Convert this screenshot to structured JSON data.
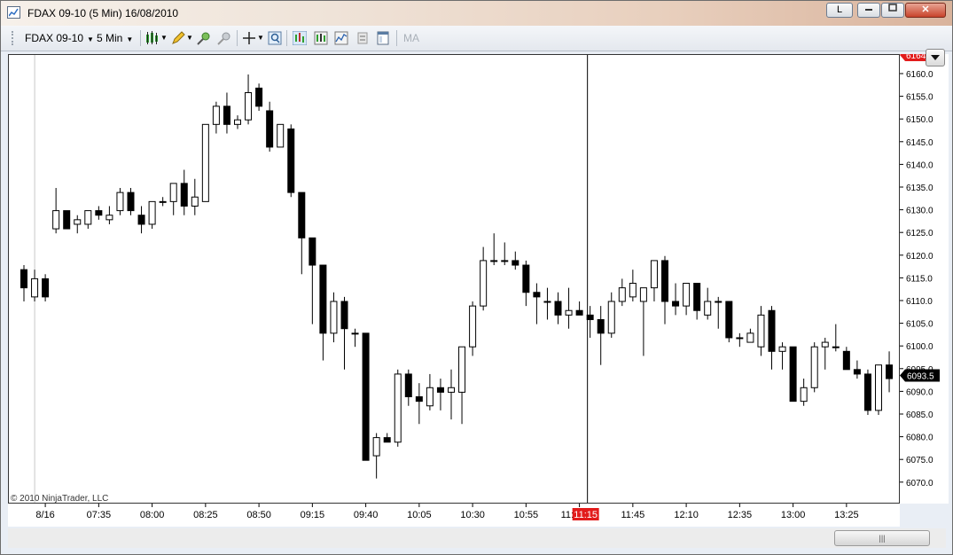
{
  "window": {
    "title": "FDAX 09-10 (5 Min)  16/08/2010",
    "buttons": {
      "link": "L",
      "minimize": "",
      "maximize": "",
      "close": "✕"
    }
  },
  "toolbar": {
    "instrument": "FDAX 09-10",
    "interval": "5 Min",
    "indicator_label": "MA"
  },
  "copyright": "© 2010 NinjaTrader, LLC",
  "crosshair_time_label": "11:15",
  "colors": {
    "up": "#ffffff",
    "down": "#000000",
    "wick": "#000000",
    "badge_red": "#e21b1b",
    "last_price_badge": "#000000"
  },
  "chart_data": {
    "type": "candlestick",
    "title": "",
    "xlabel": "",
    "ylabel": "",
    "ylim": [
      6067,
      6165
    ],
    "grid": false,
    "y_ticks": [
      "6160.0",
      "6155.0",
      "6150.0",
      "6145.0",
      "6140.0",
      "6135.0",
      "6130.0",
      "6125.0",
      "6120.0",
      "6115.0",
      "6110.0",
      "6105.0",
      "6100.0",
      "6095.0",
      "6090.0",
      "6085.0",
      "6080.0",
      "6075.0",
      "6070.0"
    ],
    "x_tick_labels": [
      "8/16",
      "07:35",
      "08:00",
      "08:25",
      "08:50",
      "09:15",
      "09:40",
      "10:05",
      "10:30",
      "10:55",
      "11:15:20",
      "11:45",
      "12:10",
      "12:35",
      "13:00",
      "13:25"
    ],
    "x_tick_bar_index": [
      2,
      7,
      12,
      17,
      22,
      27,
      32,
      37,
      42,
      47,
      52,
      57,
      62,
      67,
      72,
      77
    ],
    "last_price": "6093.5",
    "top_badge": "6164",
    "crosshair_bar_index": 53,
    "session_break_bar_index": 2,
    "candles": [
      {
        "o": 6117,
        "h": 6118,
        "l": 6110,
        "c": 6113
      },
      {
        "o": 6111,
        "h": 6117,
        "l": 6110,
        "c": 6115
      },
      {
        "o": 6115,
        "h": 6116,
        "l": 6110,
        "c": 6111
      },
      {
        "o": 6126,
        "h": 6135,
        "l": 6125,
        "c": 6130
      },
      {
        "o": 6130,
        "h": 6130,
        "l": 6126,
        "c": 6126
      },
      {
        "o": 6127,
        "h": 6129,
        "l": 6125,
        "c": 6128
      },
      {
        "o": 6127,
        "h": 6130,
        "l": 6126,
        "c": 6130
      },
      {
        "o": 6130,
        "h": 6131,
        "l": 6128,
        "c": 6129
      },
      {
        "o": 6128,
        "h": 6131,
        "l": 6127,
        "c": 6129
      },
      {
        "o": 6130,
        "h": 6135,
        "l": 6129,
        "c": 6134
      },
      {
        "o": 6134,
        "h": 6135,
        "l": 6129,
        "c": 6130
      },
      {
        "o": 6129,
        "h": 6131,
        "l": 6125,
        "c": 6127
      },
      {
        "o": 6127,
        "h": 6132,
        "l": 6126,
        "c": 6132
      },
      {
        "o": 6132,
        "h": 6133,
        "l": 6131,
        "c": 6132
      },
      {
        "o": 6132,
        "h": 6136,
        "l": 6129,
        "c": 6136
      },
      {
        "o": 6136,
        "h": 6139,
        "l": 6129,
        "c": 6131
      },
      {
        "o": 6131,
        "h": 6137,
        "l": 6129,
        "c": 6133
      },
      {
        "o": 6132,
        "h": 6149,
        "l": 6132,
        "c": 6149
      },
      {
        "o": 6149,
        "h": 6154,
        "l": 6147,
        "c": 6153
      },
      {
        "o": 6153,
        "h": 6156,
        "l": 6147,
        "c": 6149
      },
      {
        "o": 6149,
        "h": 6151,
        "l": 6148,
        "c": 6150
      },
      {
        "o": 6150,
        "h": 6160,
        "l": 6149,
        "c": 6156
      },
      {
        "o": 6157,
        "h": 6158,
        "l": 6152,
        "c": 6153
      },
      {
        "o": 6152,
        "h": 6154,
        "l": 6143,
        "c": 6144
      },
      {
        "o": 6144,
        "h": 6149,
        "l": 6144,
        "c": 6149
      },
      {
        "o": 6148,
        "h": 6149,
        "l": 6133,
        "c": 6134
      },
      {
        "o": 6134,
        "h": 6134,
        "l": 6116,
        "c": 6124
      },
      {
        "o": 6124,
        "h": 6124,
        "l": 6105,
        "c": 6118
      },
      {
        "o": 6118,
        "h": 6118,
        "l": 6097,
        "c": 6103
      },
      {
        "o": 6103,
        "h": 6112,
        "l": 6101,
        "c": 6110
      },
      {
        "o": 6110,
        "h": 6111,
        "l": 6095,
        "c": 6104
      },
      {
        "o": 6103,
        "h": 6104,
        "l": 6100,
        "c": 6103
      },
      {
        "o": 6103,
        "h": 6103,
        "l": 6075,
        "c": 6075
      },
      {
        "o": 6076,
        "h": 6081,
        "l": 6071,
        "c": 6080
      },
      {
        "o": 6080,
        "h": 6081,
        "l": 6079,
        "c": 6079
      },
      {
        "o": 6079,
        "h": 6095,
        "l": 6078,
        "c": 6094
      },
      {
        "o": 6094,
        "h": 6095,
        "l": 6087,
        "c": 6089
      },
      {
        "o": 6089,
        "h": 6092,
        "l": 6083,
        "c": 6088
      },
      {
        "o": 6087,
        "h": 6094,
        "l": 6086,
        "c": 6091
      },
      {
        "o": 6091,
        "h": 6093,
        "l": 6086,
        "c": 6090
      },
      {
        "o": 6090,
        "h": 6095,
        "l": 6084,
        "c": 6091
      },
      {
        "o": 6090,
        "h": 6100,
        "l": 6083,
        "c": 6100
      },
      {
        "o": 6100,
        "h": 6110,
        "l": 6098,
        "c": 6109
      },
      {
        "o": 6109,
        "h": 6122,
        "l": 6108,
        "c": 6119
      },
      {
        "o": 6119,
        "h": 6125,
        "l": 6118,
        "c": 6119
      },
      {
        "o": 6119,
        "h": 6123,
        "l": 6118,
        "c": 6119
      },
      {
        "o": 6119,
        "h": 6121,
        "l": 6117,
        "c": 6118
      },
      {
        "o": 6118,
        "h": 6119,
        "l": 6109,
        "c": 6112
      },
      {
        "o": 6112,
        "h": 6114,
        "l": 6105,
        "c": 6111
      },
      {
        "o": 6110,
        "h": 6113,
        "l": 6106,
        "c": 6110
      },
      {
        "o": 6110,
        "h": 6112,
        "l": 6105,
        "c": 6107
      },
      {
        "o": 6107,
        "h": 6113,
        "l": 6104,
        "c": 6108
      },
      {
        "o": 6108,
        "h": 6110,
        "l": 6107,
        "c": 6107
      },
      {
        "o": 6107,
        "h": 6109,
        "l": 6102,
        "c": 6106
      },
      {
        "o": 6106,
        "h": 6109,
        "l": 6096,
        "c": 6103
      },
      {
        "o": 6103,
        "h": 6112,
        "l": 6102,
        "c": 6110
      },
      {
        "o": 6110,
        "h": 6115,
        "l": 6109,
        "c": 6113
      },
      {
        "o": 6111,
        "h": 6117,
        "l": 6110,
        "c": 6114
      },
      {
        "o": 6110,
        "h": 6113,
        "l": 6098,
        "c": 6113
      },
      {
        "o": 6113,
        "h": 6118,
        "l": 6110,
        "c": 6119
      },
      {
        "o": 6119,
        "h": 6120,
        "l": 6105,
        "c": 6110
      },
      {
        "o": 6110,
        "h": 6114,
        "l": 6107,
        "c": 6109
      },
      {
        "o": 6109,
        "h": 6113,
        "l": 6107,
        "c": 6114
      },
      {
        "o": 6114,
        "h": 6114,
        "l": 6106,
        "c": 6108
      },
      {
        "o": 6107,
        "h": 6113,
        "l": 6106,
        "c": 6110
      },
      {
        "o": 6110,
        "h": 6111,
        "l": 6104,
        "c": 6110
      },
      {
        "o": 6110,
        "h": 6110,
        "l": 6101,
        "c": 6102
      },
      {
        "o": 6102,
        "h": 6103,
        "l": 6100,
        "c": 6102
      },
      {
        "o": 6101,
        "h": 6104,
        "l": 6101,
        "c": 6103
      },
      {
        "o": 6100,
        "h": 6109,
        "l": 6098,
        "c": 6107
      },
      {
        "o": 6108,
        "h": 6109,
        "l": 6095,
        "c": 6099
      },
      {
        "o": 6099,
        "h": 6101,
        "l": 6095,
        "c": 6100
      },
      {
        "o": 6100,
        "h": 6100,
        "l": 6088,
        "c": 6088
      },
      {
        "o": 6088,
        "h": 6093,
        "l": 6087,
        "c": 6091
      },
      {
        "o": 6091,
        "h": 6101,
        "l": 6090,
        "c": 6100
      },
      {
        "o": 6100,
        "h": 6102,
        "l": 6095,
        "c": 6101
      },
      {
        "o": 6100,
        "h": 6105,
        "l": 6099,
        "c": 6100
      },
      {
        "o": 6099,
        "h": 6100,
        "l": 6096,
        "c": 6095
      },
      {
        "o": 6095,
        "h": 6097,
        "l": 6093,
        "c": 6094
      },
      {
        "o": 6094,
        "h": 6095,
        "l": 6085,
        "c": 6086
      },
      {
        "o": 6086,
        "h": 6096,
        "l": 6085,
        "c": 6096
      },
      {
        "o": 6096,
        "h": 6099,
        "l": 6090,
        "c": 6093
      }
    ]
  }
}
